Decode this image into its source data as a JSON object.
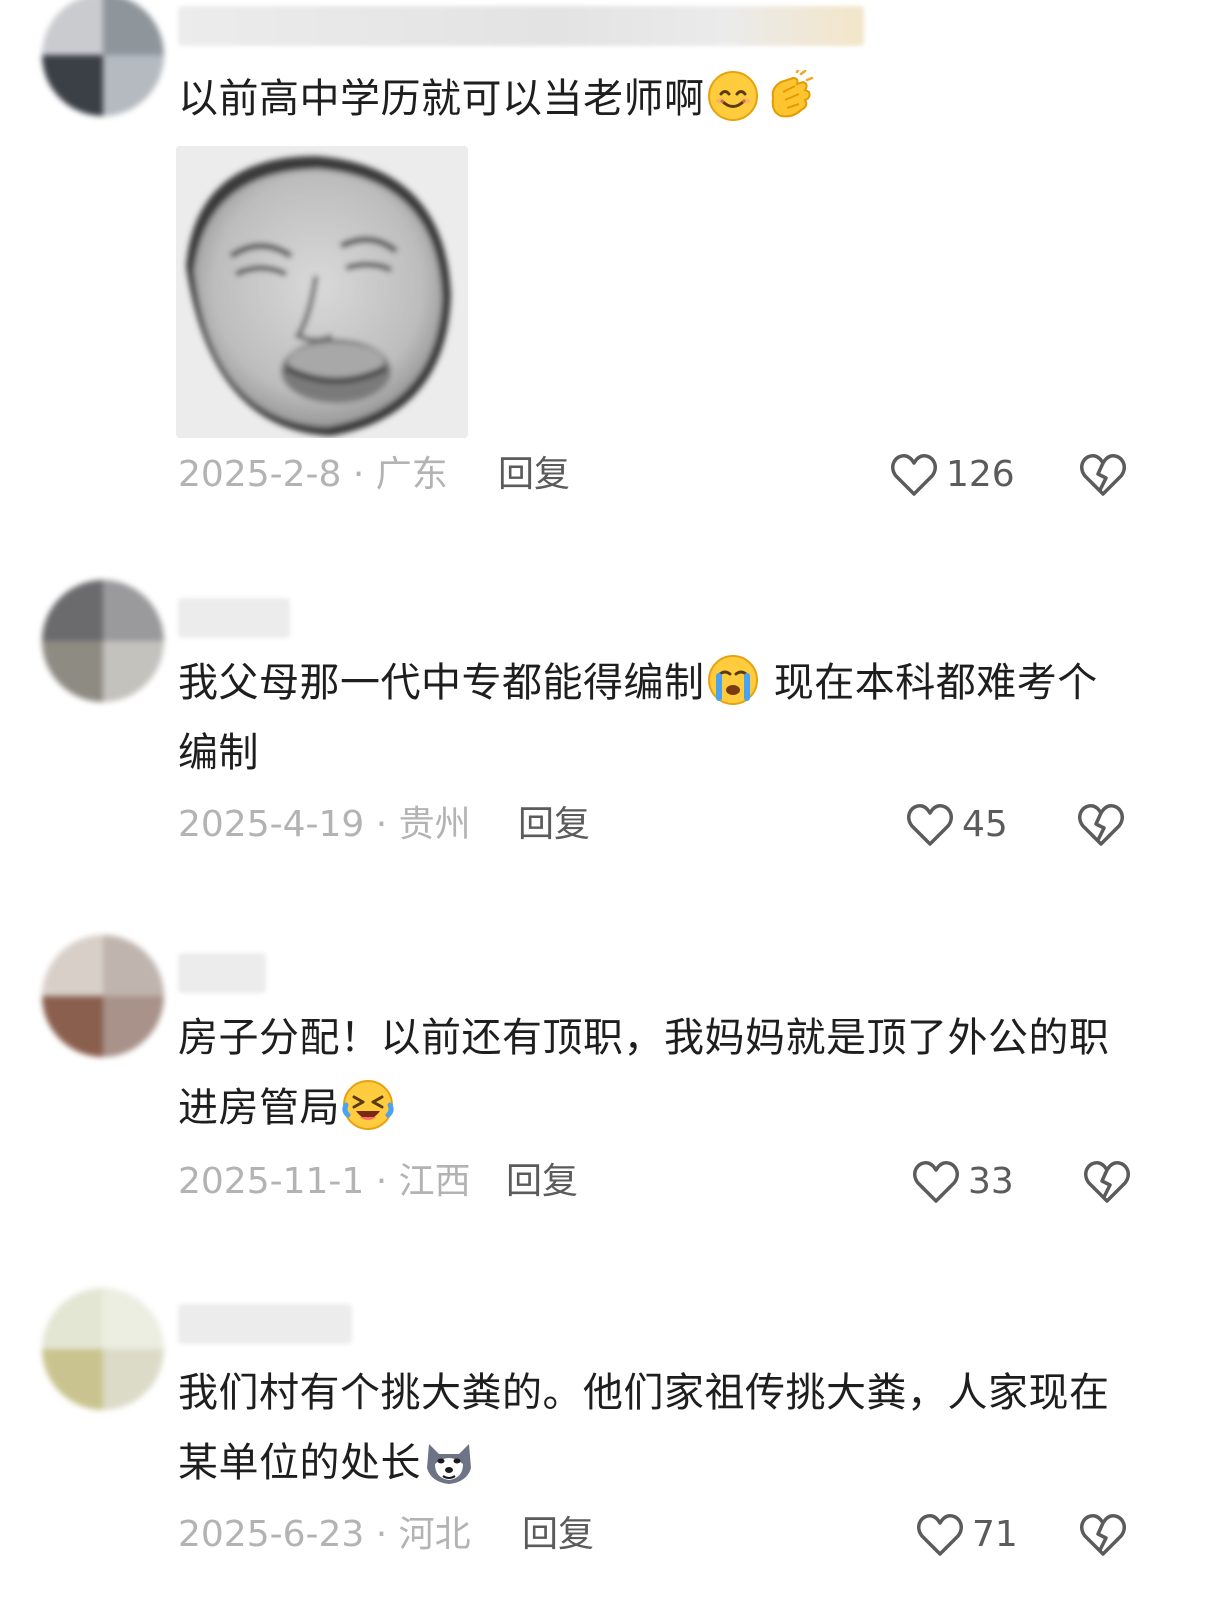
{
  "comments": [
    {
      "text": "以前高中学历就可以当老师啊",
      "emojis": [
        "smiling-face-icon",
        "clapping-hands-icon"
      ],
      "has_sticker": true,
      "date": "2025-2-8",
      "location": "广东",
      "date_location": "2025-2-8 · 广东",
      "reply_label": "回复",
      "likes": "126"
    },
    {
      "text_a": "我父母那一代中专都能得编制",
      "text_b": " 现在本科都难考个编制",
      "emojis": [
        "crying-face-icon"
      ],
      "date": "2025-4-19",
      "location": "贵州",
      "date_location": "2025-4-19 · 贵州",
      "reply_label": "回复",
      "likes": "45"
    },
    {
      "text": "房子分配！以前还有顶职，我妈妈就是顶了外公的职进房管局",
      "emojis": [
        "laughing-crying-face-icon"
      ],
      "date": "2025-11-1",
      "location": "江西",
      "date_location": "2025-11-1 · 江西",
      "reply_label": "回复",
      "likes": "33"
    },
    {
      "text": "我们村有个挑大粪的。他们家祖传挑大粪，人家现在某单位的处长",
      "emojis": [
        "husky-face-icon"
      ],
      "date": "2025-6-23",
      "location": "河北",
      "date_location": "2025-6-23 · 河北",
      "reply_label": "回复",
      "likes": "71"
    }
  ],
  "colors": {
    "text": "#1e1e1e",
    "meta": "#b3b3b3",
    "action": "#5b5b5b",
    "background": "#ffffff"
  }
}
